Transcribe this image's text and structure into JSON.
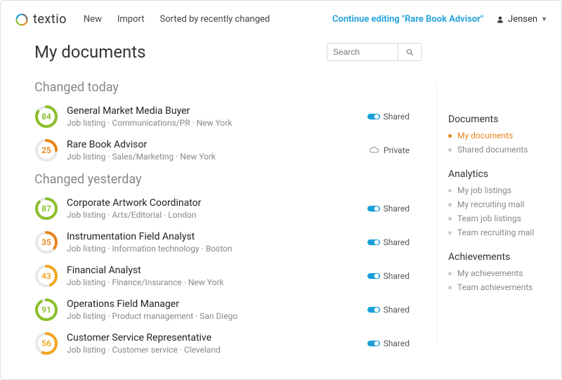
{
  "logo_text": "textio",
  "nav": {
    "new": "New",
    "import": "Import",
    "sort": "Sorted by recently changed"
  },
  "continue_editing": "Continue editing \"Rare Book Advisor\"",
  "user_name": "Jensen",
  "page_title": "My documents",
  "search": {
    "placeholder": "Search"
  },
  "sections": {
    "today": "Changed today",
    "yesterday": "Changed yesterday"
  },
  "docs_today": [
    {
      "score": "84",
      "color": "#8bbf2b",
      "title": "General Market Media Buyer",
      "meta": "Job listing · Communications/PR · New York",
      "status": "Shared",
      "shared": true
    },
    {
      "score": "25",
      "color": "#e8841a",
      "title": "Rare Book Advisor",
      "meta": "Job listing · Sales/Marketing · New York",
      "status": "Private",
      "shared": false
    }
  ],
  "docs_yesterday": [
    {
      "score": "87",
      "color": "#8bbf2b",
      "title": "Corporate Artwork Coordinator",
      "meta": "Job listing · Arts/Editorial · London",
      "status": "Shared",
      "shared": true
    },
    {
      "score": "35",
      "color": "#e8841a",
      "title": "Instrumentation Field Analyst",
      "meta": "Job listing · Information technology · Boston",
      "status": "Shared",
      "shared": true
    },
    {
      "score": "43",
      "color": "#f0a61e",
      "title": "Financial Analyst",
      "meta": "Job listing · Finance/Insurance · New York",
      "status": "Shared",
      "shared": true
    },
    {
      "score": "91",
      "color": "#8bbf2b",
      "title": "Operations Field Manager",
      "meta": "Job listing · Product management · San Diego",
      "status": "Shared",
      "shared": true
    },
    {
      "score": "56",
      "color": "#f0a61e",
      "title": "Customer Service Representative",
      "meta": "Job listing · Customer service · Cleveland",
      "status": "Shared",
      "shared": true
    }
  ],
  "sidebar": {
    "groups": [
      {
        "heading": "Documents",
        "items": [
          {
            "label": "My documents",
            "active": true
          },
          {
            "label": "Shared documents",
            "active": false
          }
        ]
      },
      {
        "heading": "Analytics",
        "items": [
          {
            "label": "My job listings"
          },
          {
            "label": "My recruiting mail"
          },
          {
            "label": "Team job listings"
          },
          {
            "label": "Team recruiting mail"
          }
        ]
      },
      {
        "heading": "Achievements",
        "items": [
          {
            "label": "My achievements"
          },
          {
            "label": "Team achievements"
          }
        ]
      }
    ]
  }
}
